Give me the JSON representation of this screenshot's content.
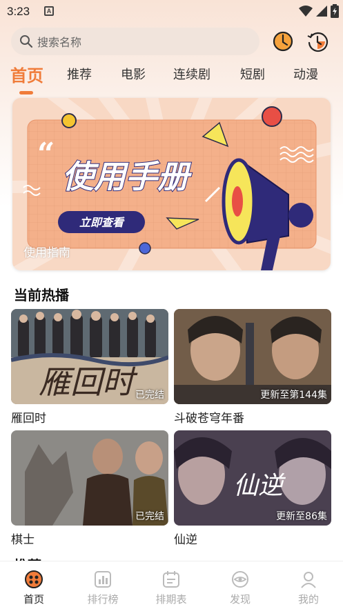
{
  "status": {
    "time": "3:23",
    "notification_letter": "A"
  },
  "search": {
    "placeholder": "搜索名称"
  },
  "tabs": [
    {
      "label": "首页",
      "active": true
    },
    {
      "label": "推荐"
    },
    {
      "label": "电影"
    },
    {
      "label": "连续剧"
    },
    {
      "label": "短剧"
    },
    {
      "label": "动漫"
    }
  ],
  "banner": {
    "headline": "使用手册",
    "quote_mark": "“",
    "button_label": "立即查看",
    "caption": "使用指南"
  },
  "sections": {
    "hot": "当前热播",
    "recommend": "推荐"
  },
  "cards": [
    {
      "title": "雁回时",
      "badge": "已完结",
      "poster_text": "雁回时"
    },
    {
      "title": "斗破苍穹年番",
      "badge": "更新至第144集"
    },
    {
      "title": "棋士",
      "badge": "已完结"
    },
    {
      "title": "仙逆",
      "badge": "更新至86集",
      "poster_text": "仙逆"
    }
  ],
  "bottom_nav": [
    {
      "label": "首页",
      "icon": "home-icon",
      "active": true
    },
    {
      "label": "排行榜",
      "icon": "ranking-icon"
    },
    {
      "label": "排期表",
      "icon": "schedule-icon"
    },
    {
      "label": "发现",
      "icon": "discover-icon"
    },
    {
      "label": "我的",
      "icon": "profile-icon"
    }
  ],
  "colors": {
    "accent": "#f07c3a",
    "banner_bg": "#f4b08a",
    "button": "#2f2a79"
  }
}
